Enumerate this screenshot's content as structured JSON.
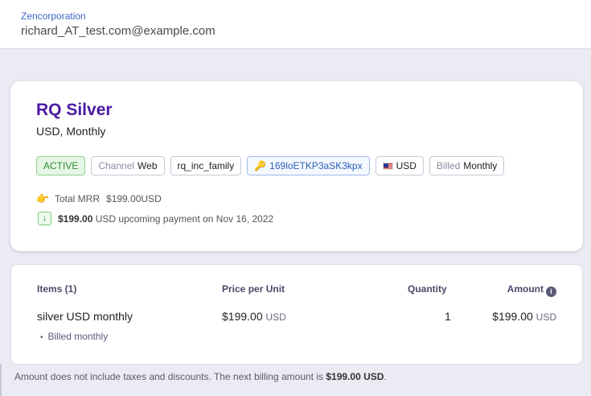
{
  "header": {
    "org_name": "Zencorporation",
    "user_email": "richard_AT_test.com@example.com"
  },
  "subscription": {
    "plan_name": "RQ Silver",
    "plan_subtitle": "USD, Monthly",
    "badges": {
      "status": "ACTIVE",
      "channel_label": "Channel",
      "channel_value": "Web",
      "family": "rq_inc_family",
      "key_id": "169loETKP3aSK3kpx",
      "currency": "USD",
      "billed_label": "Billed",
      "billed_value": "Monthly"
    },
    "mrr_label": "Total MRR",
    "mrr_value": "$199.00USD",
    "upcoming_amount": "$199.00",
    "upcoming_text": "USD upcoming payment on Nov 16, 2022"
  },
  "items_table": {
    "headers": {
      "items": "Items (1)",
      "price": "Price per Unit",
      "quantity": "Quantity",
      "amount": "Amount"
    },
    "rows": [
      {
        "name": "silver USD monthly",
        "price": "$199.00",
        "price_currency": "USD",
        "quantity": "1",
        "amount": "$199.00",
        "amount_currency": "USD",
        "detail": "Billed monthly"
      }
    ]
  },
  "footnote": {
    "text": "Amount does not include taxes and discounts. The next billing amount is",
    "amount": "$199.00 USD",
    "end": "."
  },
  "colors": {
    "plan_name": "#4b1aa3",
    "link": "#3b66c4",
    "active_badge": "#2f8a2f"
  },
  "icons": [
    "pointing-hand-icon",
    "download-arrow-icon",
    "key-icon",
    "us-flag-icon",
    "info-icon"
  ]
}
